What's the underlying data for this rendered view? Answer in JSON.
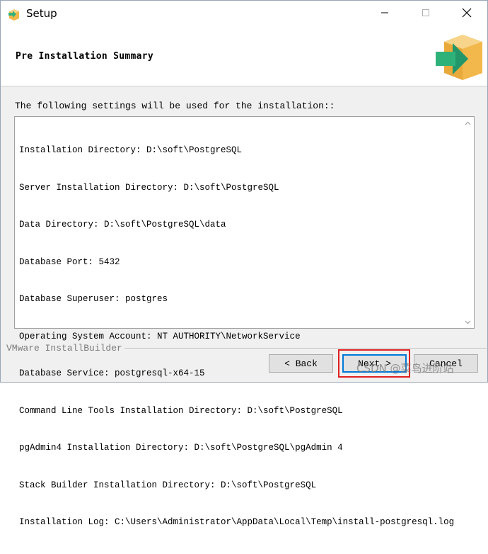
{
  "window": {
    "title": "Setup"
  },
  "header": {
    "title": "Pre Installation Summary"
  },
  "main": {
    "intro": "The following settings will be used for the installation::",
    "summary_lines": [
      "Installation Directory: D:\\soft\\PostgreSQL",
      "Server Installation Directory: D:\\soft\\PostgreSQL",
      "Data Directory: D:\\soft\\PostgreSQL\\data",
      "Database Port: 5432",
      "Database Superuser: postgres",
      "Operating System Account: NT AUTHORITY\\NetworkService",
      "Database Service: postgresql-x64-15",
      "Command Line Tools Installation Directory: D:\\soft\\PostgreSQL",
      "pgAdmin4 Installation Directory: D:\\soft\\PostgreSQL\\pgAdmin 4",
      "Stack Builder Installation Directory: D:\\soft\\PostgreSQL",
      "Installation Log: C:\\Users\\Administrator\\AppData\\Local\\Temp\\install-postgresql.log"
    ]
  },
  "footer": {
    "brand": "VMware InstallBuilder",
    "back_label": "< Back",
    "next_label": "Next >",
    "cancel_label": "Cancel",
    "watermark": "CSDN @菜鸟进阶站"
  },
  "icons": {
    "app": "setup-box-arrow-icon",
    "logo": "box-arrow-logo-icon",
    "minimize": "minimize-icon",
    "maximize": "maximize-icon",
    "close": "close-icon",
    "scroll_up": "scroll-up-icon",
    "scroll_down": "scroll-down-icon"
  },
  "colors": {
    "accent_button_border": "#0078d7",
    "highlight": "#e02020",
    "logo_box": "#f2b84b",
    "logo_arrow": "#2fb27a"
  }
}
